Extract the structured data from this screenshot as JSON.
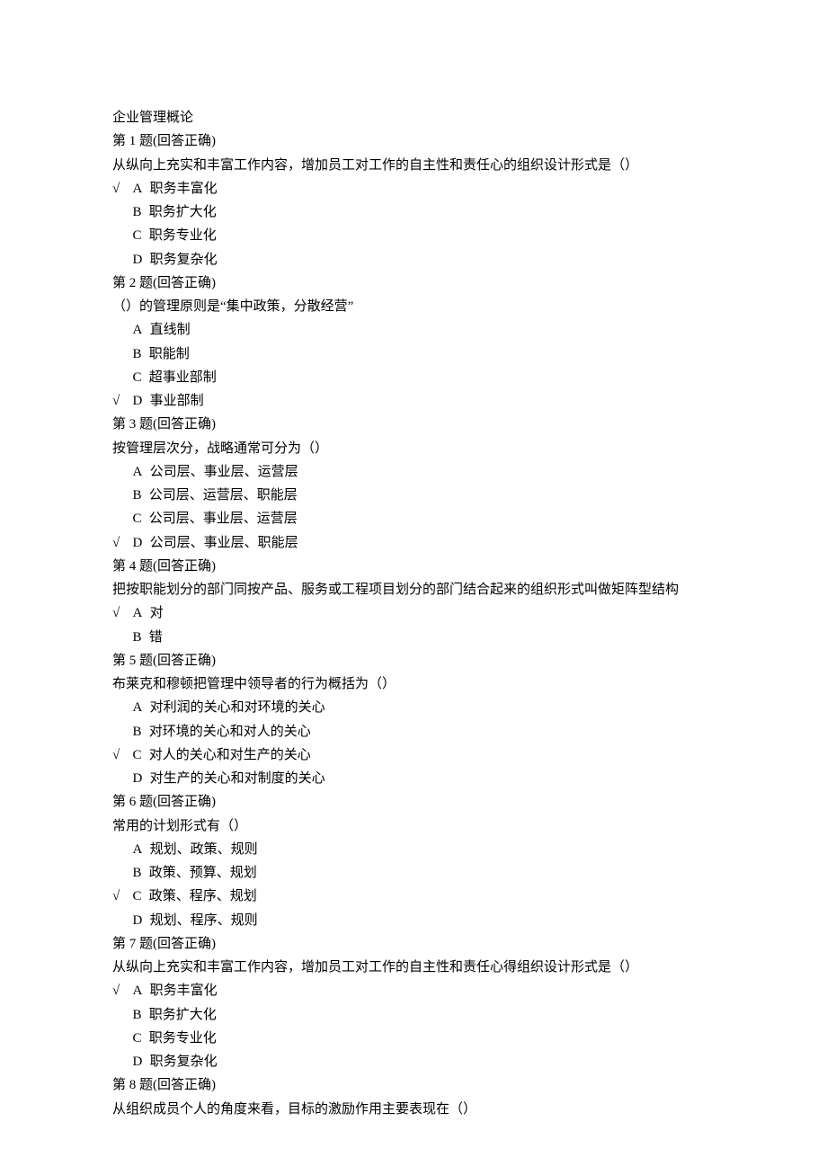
{
  "title": "企业管理概论",
  "check_mark": "√",
  "questions": [
    {
      "number": "1",
      "status": "(回答正确)",
      "prompt": "从纵向上充实和丰富工作内容，增加员工对工作的自主性和责任心的组织设计形式是（）",
      "options": [
        {
          "letter": "A",
          "text": "职务丰富化",
          "correct": true
        },
        {
          "letter": "B",
          "text": "职务扩大化",
          "correct": false
        },
        {
          "letter": "C",
          "text": "职务专业化",
          "correct": false
        },
        {
          "letter": "D",
          "text": "职务复杂化",
          "correct": false
        }
      ]
    },
    {
      "number": "2",
      "status": "(回答正确)",
      "prompt": "（）的管理原则是“集中政策，分散经营”",
      "options": [
        {
          "letter": "A",
          "text": "直线制",
          "correct": false
        },
        {
          "letter": "B",
          "text": "职能制",
          "correct": false
        },
        {
          "letter": "C",
          "text": "超事业部制",
          "correct": false
        },
        {
          "letter": "D",
          "text": "事业部制",
          "correct": true
        }
      ]
    },
    {
      "number": "3",
      "status": "(回答正确)",
      "prompt": "按管理层次分，战略通常可分为（）",
      "options": [
        {
          "letter": "A",
          "text": "公司层、事业层、运营层",
          "correct": false
        },
        {
          "letter": "B",
          "text": "公司层、运营层、职能层",
          "correct": false
        },
        {
          "letter": "C",
          "text": "公司层、事业层、运营层",
          "correct": false
        },
        {
          "letter": "D",
          "text": "公司层、事业层、职能层",
          "correct": true
        }
      ]
    },
    {
      "number": "4",
      "status": "(回答正确)",
      "prompt": "把按职能划分的部门同按产品、服务或工程项目划分的部门结合起来的组织形式叫做矩阵型结构",
      "options": [
        {
          "letter": "A",
          "text": "对",
          "correct": true
        },
        {
          "letter": "B",
          "text": "错",
          "correct": false
        }
      ]
    },
    {
      "number": "5",
      "status": "(回答正确)",
      "prompt": "布莱克和穆顿把管理中领导者的行为概括为（）",
      "options": [
        {
          "letter": "A",
          "text": "对利润的关心和对环境的关心",
          "correct": false
        },
        {
          "letter": "B",
          "text": "对环境的关心和对人的关心",
          "correct": false
        },
        {
          "letter": "C",
          "text": "对人的关心和对生产的关心",
          "correct": true
        },
        {
          "letter": "D",
          "text": "对生产的关心和对制度的关心",
          "correct": false
        }
      ]
    },
    {
      "number": "6",
      "status": "(回答正确)",
      "prompt": "常用的计划形式有（）",
      "options": [
        {
          "letter": "A",
          "text": "规划、政策、规则",
          "correct": false
        },
        {
          "letter": "B",
          "text": "政策、预算、规划",
          "correct": false
        },
        {
          "letter": "C",
          "text": "政策、程序、规划",
          "correct": true
        },
        {
          "letter": "D",
          "text": "规划、程序、规则",
          "correct": false
        }
      ]
    },
    {
      "number": "7",
      "status": "(回答正确)",
      "prompt": "从纵向上充实和丰富工作内容，增加员工对工作的自主性和责任心得组织设计形式是（）",
      "options": [
        {
          "letter": "A",
          "text": "职务丰富化",
          "correct": true
        },
        {
          "letter": "B",
          "text": "职务扩大化",
          "correct": false
        },
        {
          "letter": "C",
          "text": "职务专业化",
          "correct": false
        },
        {
          "letter": "D",
          "text": "职务复杂化",
          "correct": false
        }
      ]
    },
    {
      "number": "8",
      "status": "(回答正确)",
      "prompt": "从组织成员个人的角度来看，目标的激励作用主要表现在（）",
      "options": []
    }
  ],
  "labels": {
    "question_prefix": "第",
    "question_suffix": "题"
  }
}
